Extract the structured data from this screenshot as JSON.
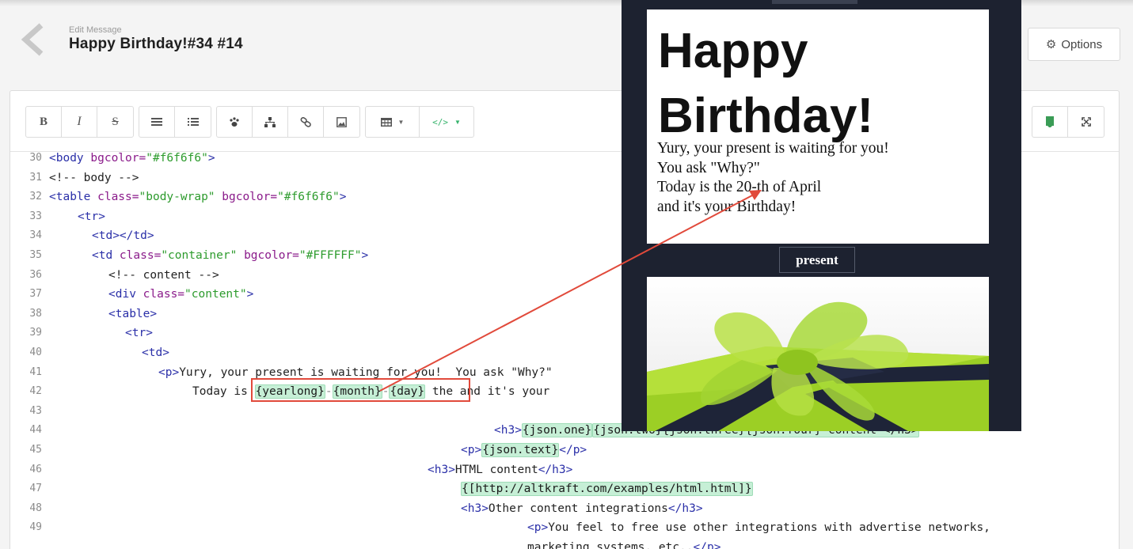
{
  "header": {
    "subtitle": "Edit Message",
    "title": "Happy Birthday!#34 #14",
    "options_label": "Options"
  },
  "toolbar": {
    "bold": "B",
    "italic": "I",
    "strike": "S"
  },
  "code": {
    "line_numbers": [
      "30",
      "31",
      "32",
      "33",
      "34",
      "35",
      "36",
      "37",
      "38",
      "39",
      "40",
      "41",
      "42",
      "43",
      "44",
      "45",
      "46",
      "47",
      "48",
      "49"
    ],
    "l30_tag1": "<body ",
    "l30_attr": "bgcolor=",
    "l30_str": "\"#f6f6f6\"",
    "l30_tag2": ">",
    "l31": "<!-- body -->",
    "l32_tag1": "<table ",
    "l32_a1": "class=",
    "l32_s1": "\"body-wrap\"",
    "l32_a2": " bgcolor=",
    "l32_s2": "\"#f6f6f6\"",
    "l32_tag2": ">",
    "l33": "<tr>",
    "l34": "<td></td>",
    "l35_tag1": "<td ",
    "l35_a1": "class=",
    "l35_s1": "\"container\"",
    "l35_a2": " bgcolor=",
    "l35_s2": "\"#FFFFFF\"",
    "l35_tag2": ">",
    "l36": "<!-- content -->",
    "l37_tag1": "<div ",
    "l37_a1": "class=",
    "l37_s1": "\"content\"",
    "l37_tag2": ">",
    "l38": "<table>",
    "l39": "<tr>",
    "l40": "<td>",
    "l41_tag": "<p>",
    "l41_text": "Yury, your present is waiting for you!  You ask \"Why?\"",
    "l42_prefix": "Today is ",
    "l42_v1": "{yearlong}",
    "l42_d1": "-",
    "l42_v2": "{month}",
    "l42_d2": "-",
    "l42_v3": "{day}",
    "l42_suffix": " the and it's your",
    "l44_tag": "<h3>",
    "l44_v": "{json.one}",
    "l44_rest": "{json.two}{json.three}{json.four} content </h3>",
    "l45_tag1": "<p>",
    "l45_v": "{json.text}",
    "l45_tag2": "</p>",
    "l46_tag1": "<h3>",
    "l46_text": "HTML content",
    "l46_tag2": "</h3>",
    "l47_v": "{[http://altkraft.com/examples/html.html]}",
    "l48_tag1": "<h3>",
    "l48_text": "Other content integrations",
    "l48_tag2": "</h3>",
    "l49_tag1": "<p>",
    "l49_text": "You feel to free use other integrations with advertise networks,",
    "l50_text": "marketing systems, etc..",
    "l50_tag2": "</p>"
  },
  "preview": {
    "heading": "Happy Birthday!",
    "line1": "Yury, your present is waiting for you!",
    "line2": "You ask \"Why?\"",
    "line3": "Today is the 20-th of April",
    "line4": "and it's your Birthday!",
    "button": "present"
  },
  "colors": {
    "annotation": "#e14a3b",
    "preview_bg": "#1d2230",
    "variable_bg": "#c6efd6",
    "gift_green": "#a6d92b"
  }
}
